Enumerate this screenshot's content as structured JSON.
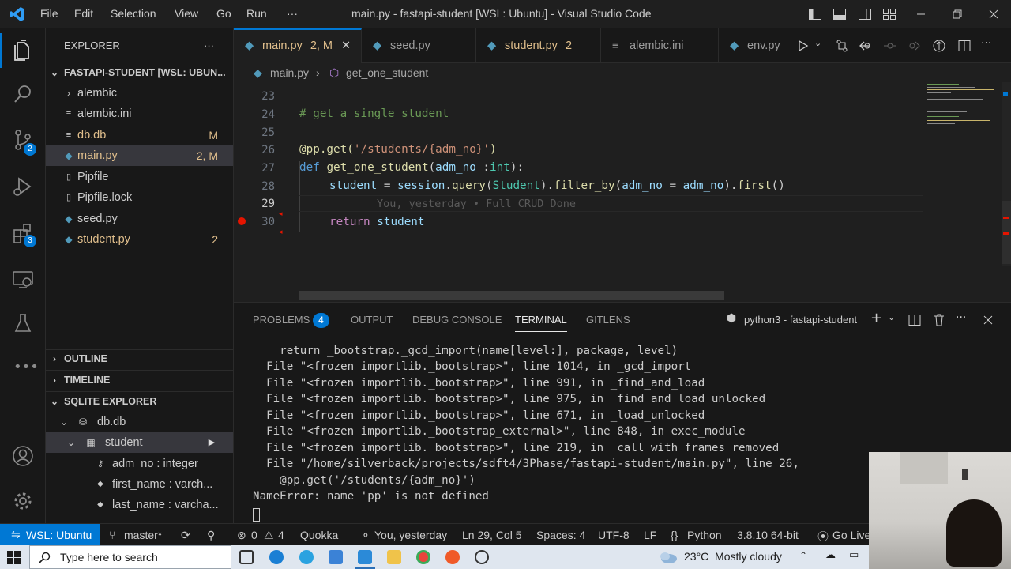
{
  "titlebar": {
    "menus": [
      "File",
      "Edit",
      "Selection",
      "View",
      "Go",
      "Run",
      "···"
    ],
    "title": "main.py - fastapi-student [WSL: Ubuntu] - Visual Studio Code"
  },
  "activity": {
    "scm_badge": "2",
    "ext_badge": "3"
  },
  "sidebar": {
    "explorer_title": "EXPLORER",
    "explorer_more": "···",
    "root": "FASTAPI-STUDENT [WSL: UBUN...",
    "files": [
      {
        "name": "alembic",
        "badge": ""
      },
      {
        "name": "alembic.ini",
        "badge": ""
      },
      {
        "name": "db.db",
        "badge": "M"
      },
      {
        "name": "main.py",
        "badge": "2, M"
      },
      {
        "name": "Pipfile",
        "badge": ""
      },
      {
        "name": "Pipfile.lock",
        "badge": ""
      },
      {
        "name": "seed.py",
        "badge": ""
      },
      {
        "name": "student.py",
        "badge": "2"
      }
    ],
    "outline": "OUTLINE",
    "timeline": "TIMELINE",
    "sqlite": "SQLITE EXPLORER",
    "db": "db.db",
    "table": "student",
    "columns": [
      "adm_no : integer",
      "first_name : varch...",
      "last_name : varcha..."
    ]
  },
  "tabs": [
    {
      "label": "main.py",
      "suffix": "2, M"
    },
    {
      "label": "seed.py",
      "suffix": ""
    },
    {
      "label": "student.py",
      "suffix": "2"
    },
    {
      "label": "alembic.ini",
      "suffix": ""
    },
    {
      "label": "env.py",
      "suffix": ""
    }
  ],
  "breadcrumb": {
    "file": "main.py",
    "symbol": "get_one_student"
  },
  "editor": {
    "line_numbers": [
      "23",
      "24",
      "25",
      "26",
      "27",
      "28",
      "29",
      "30"
    ],
    "comment": "# get a single student",
    "l26_dec": "@pp.get(",
    "l26_str": "'/students/{adm_no}'",
    "l26_end": ")",
    "l27_def": "def ",
    "l27_fn": "get_one_student",
    "l27_a": "(",
    "l27_param": "adm_no",
    "l27_b": " :",
    "l27_type": "int",
    "l27_c": "):",
    "l28_var": "student",
    "l28_eq": " = ",
    "l28_session": "session",
    "l28_dot1": ".",
    "l28_query": "query",
    "l28_p1": "(",
    "l28_cls": "Student",
    "l28_p2": ").",
    "l28_filter": "filter_by",
    "l28_p3": "(",
    "l28_adm": "adm_no",
    "l28_eq2": " = ",
    "l28_adm2": "adm_no",
    "l28_p4": ").",
    "l28_first": "first",
    "l28_p5": "()",
    "ghost": "You, yesterday • Full CRUD Done",
    "l30_kw": "return ",
    "l30_var": "student"
  },
  "panel": {
    "tabs": [
      "PROBLEMS",
      "OUTPUT",
      "DEBUG CONSOLE",
      "TERMINAL",
      "GITLENS"
    ],
    "problems_count": "4",
    "shell": "python3 - fastapi-student",
    "lines": [
      "    return _bootstrap._gcd_import(name[level:], package, level)",
      "  File \"<frozen importlib._bootstrap>\", line 1014, in _gcd_import",
      "  File \"<frozen importlib._bootstrap>\", line 991, in _find_and_load",
      "  File \"<frozen importlib._bootstrap>\", line 975, in _find_and_load_unlocked",
      "  File \"<frozen importlib._bootstrap>\", line 671, in _load_unlocked",
      "  File \"<frozen importlib._bootstrap_external>\", line 848, in exec_module",
      "  File \"<frozen importlib._bootstrap>\", line 219, in _call_with_frames_removed",
      "  File \"/home/silverback/projects/sdft4/3Phase/fastapi-student/main.py\", line 26,",
      "    @pp.get('/students/{adm_no}')",
      "NameError: name 'pp' is not defined"
    ]
  },
  "status": {
    "remote": "WSL: Ubuntu",
    "branch": "master*",
    "errors": "0",
    "warnings": "4",
    "quokka": "Quokka",
    "blame": "You, yesterday",
    "position": "Ln 29, Col 5",
    "spaces": "Spaces: 4",
    "encoding": "UTF-8",
    "eol": "LF",
    "language": "Python",
    "interpreter": "3.8.10 64-bit",
    "golive": "Go Live"
  },
  "taskbar": {
    "search_placeholder": "Type here to search",
    "weather": "23°C  Mostly cloudy"
  },
  "colors": {
    "accent": "#0078d4",
    "status_remote": "#0078d4",
    "modified": "#e2c08d"
  }
}
